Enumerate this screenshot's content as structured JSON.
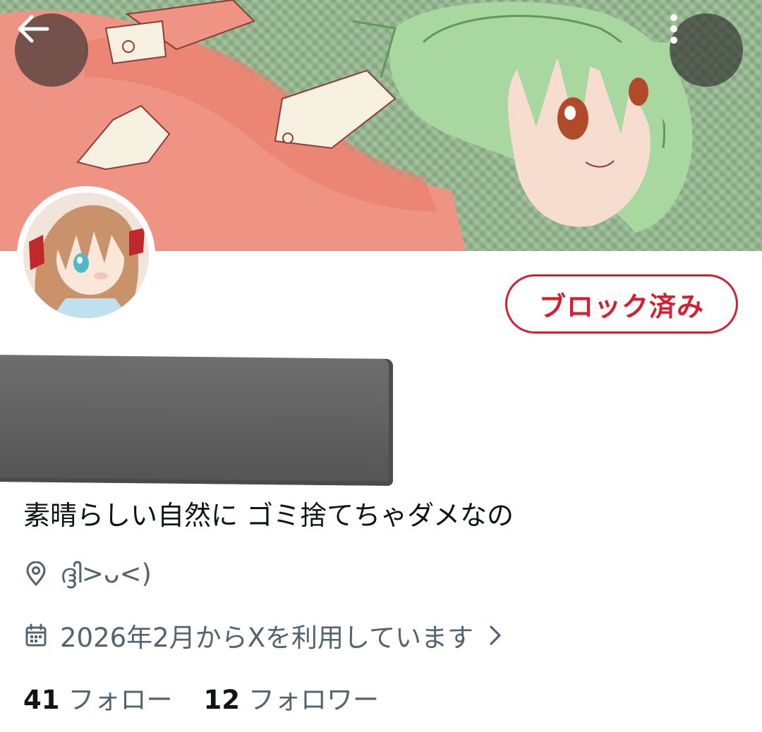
{
  "header": {
    "back_icon": "arrow-left-icon",
    "more_icon": "more-vertical-icon"
  },
  "profile": {
    "blocked_button_label": "ブロック済み",
    "bio": "素晴らしい自然に ゴミ捨てちゃダメなの",
    "location": "ദ്ദി>ᴗ<)",
    "joined": "2026年2月からXを利用しています"
  },
  "stats": {
    "following_count": "41",
    "following_label": "フォロー",
    "followers_count": "12",
    "followers_label": "フォロワー"
  },
  "colors": {
    "blocked_red": "#d71e30",
    "secondary_text": "#536471",
    "primary_text": "#0f1419"
  }
}
